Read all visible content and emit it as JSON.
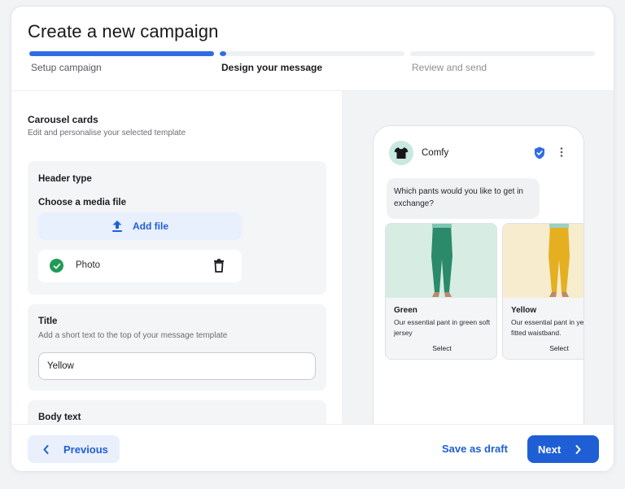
{
  "header": {
    "title": "Create a new campaign"
  },
  "stepper": {
    "steps": [
      {
        "label": "Setup campaign",
        "state": "complete"
      },
      {
        "label": "Design your message",
        "state": "current"
      },
      {
        "label": "Review and send",
        "state": "upcoming"
      }
    ]
  },
  "editor": {
    "section_title": "Carousel cards",
    "section_subtitle": "Edit and personalise your selected template",
    "header_type": {
      "title": "Header type",
      "media_label": "Choose a media file",
      "add_file_label": "Add file",
      "file_name": "Photo"
    },
    "title_field": {
      "title": "Title",
      "subtitle": "Add a short text to the top of your message template",
      "value": "Yellow"
    },
    "body_text": {
      "title": "Body text"
    }
  },
  "preview": {
    "brand_name": "Comfy",
    "message": "Which pants would you like to get in exchange?",
    "cards": [
      {
        "title": "Green",
        "description": "Our essential pant in green soft jersey",
        "button": "Select"
      },
      {
        "title": "Yellow",
        "description": "Our essential pant in yellow with fitted waistband.",
        "button": "Select"
      }
    ]
  },
  "footer": {
    "previous_label": "Previous",
    "draft_label": "Save as draft",
    "next_label": "Next"
  },
  "colors": {
    "accent": "#1f5fd6",
    "progress": "#2f6ce5",
    "success": "#1f9b55",
    "verified": "#2f6ce5"
  },
  "icons": [
    "upload-icon",
    "check-circle-icon",
    "trash-icon",
    "tshirt-icon",
    "verified-badge-icon",
    "more-vertical-icon",
    "chevron-left-icon",
    "chevron-right-icon"
  ]
}
